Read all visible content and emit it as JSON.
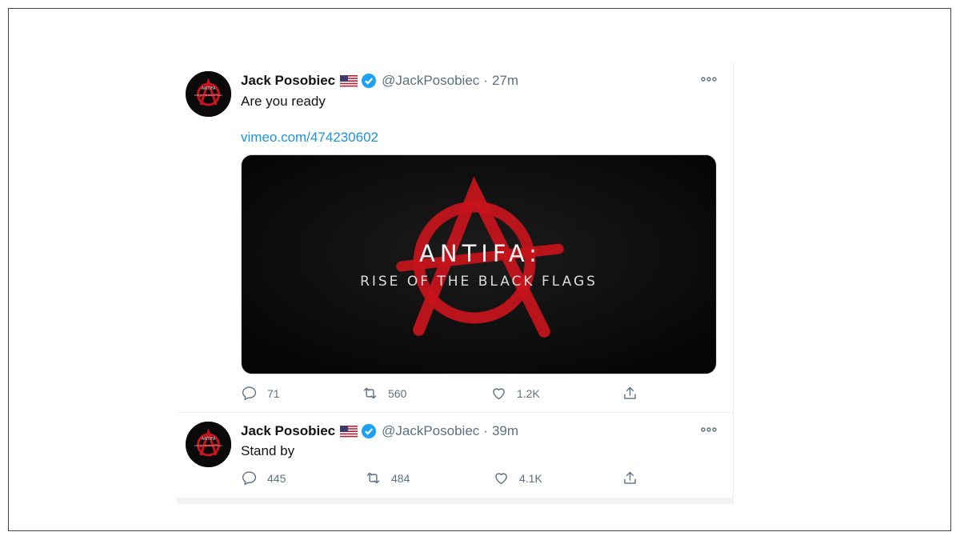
{
  "tweets": [
    {
      "author_name": "Jack Posobiec",
      "flag": "🇺🇸",
      "handle": "@JackPosobiec",
      "separator": "·",
      "time": "27m",
      "text": "Are you ready",
      "link": "vimeo.com/474230602",
      "media": {
        "title": "ANTIFA:",
        "subtitle": "RISE OF THE BLACK FLAGS"
      },
      "actions": {
        "replies": "71",
        "retweets": "560",
        "likes": "1.2K"
      },
      "avatar": {
        "caption": "ANTIFA",
        "sub_caption": "RISE OF THE BLACK FLAGS"
      }
    },
    {
      "author_name": "Jack Posobiec",
      "flag": "🇺🇸",
      "handle": "@JackPosobiec",
      "separator": "·",
      "time": "39m",
      "text": "Stand by",
      "actions": {
        "replies": "445",
        "retweets": "484",
        "likes": "4.1K"
      },
      "avatar": {
        "caption": "ANTIFA",
        "sub_caption": "RISE OF THE BLACK FLAGS"
      }
    }
  ],
  "colors": {
    "name": "#0f1419",
    "secondary": "#5b7083",
    "link": "#1b95e0",
    "verified": "#1da1f2",
    "anarchy_red": "#c8141c"
  }
}
